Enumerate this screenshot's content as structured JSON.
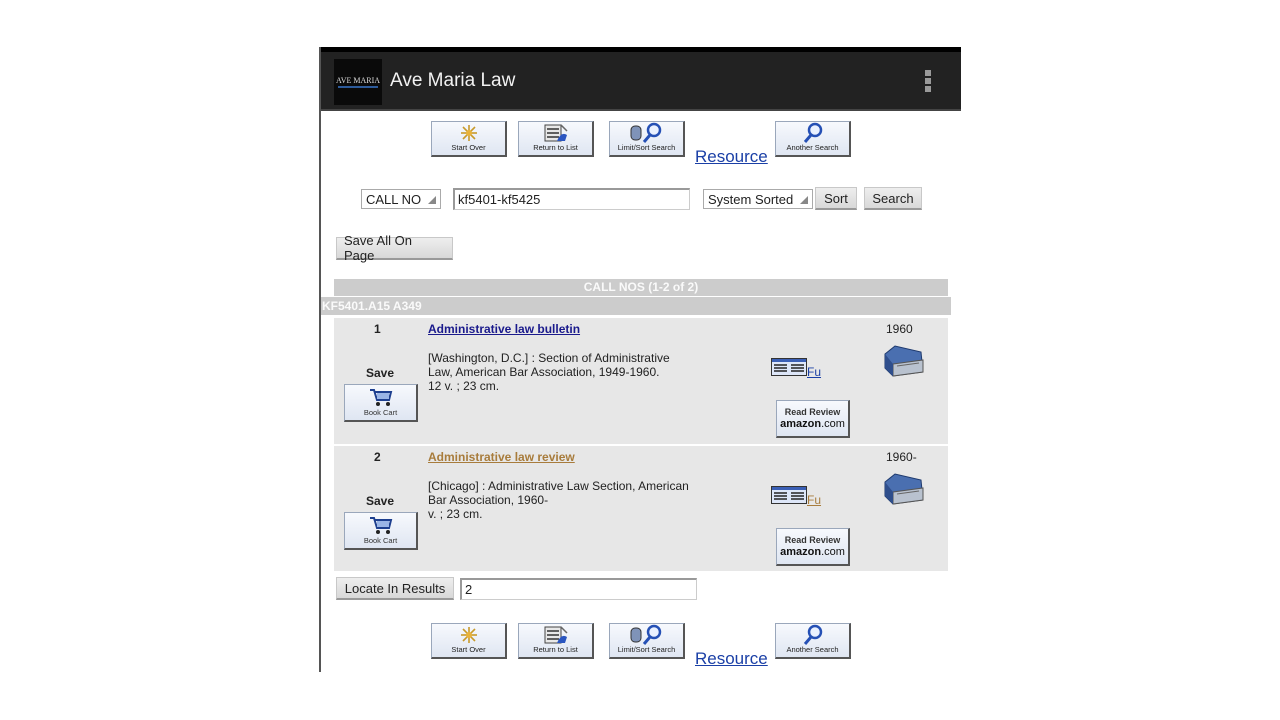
{
  "app": {
    "title": "Ave Maria Law",
    "logo_text": "AVE MARIA",
    "menu_icon": "overflow-menu-icon"
  },
  "nav": {
    "start_over": "Start Over",
    "return_to_list": "Return to List",
    "limit_sort": "Limit/Sort Search",
    "resource": "Resource",
    "another_search": "Another Search"
  },
  "search": {
    "index_select": "CALL NO",
    "query": "kf5401-kf5425",
    "sort_select": "System Sorted",
    "sort_button": "Sort",
    "search_button": "Search"
  },
  "save_all_button": "Save All On Page",
  "results": {
    "header": "CALL NOS (1-2 of 2)",
    "call_number": "KF5401.A15 A349",
    "records": [
      {
        "number": "1",
        "title": "Administrative law bulletin",
        "title_color": "#1a1a8c",
        "year": "1960",
        "description_lines": [
          "[Washington, D.C.] : Section of Administrative",
          "Law, American Bar Association, 1949-1960.",
          "12 v. ; 23 cm."
        ],
        "save_label": "Save",
        "cart_label": "Book Cart",
        "fulltext_label": "Fu",
        "review_label": "Read Review",
        "amazon_label_bold": "amazon",
        "amazon_label_rest": ".com"
      },
      {
        "number": "2",
        "title": "Administrative law review",
        "title_color": "#a87c3c",
        "year": "1960-",
        "description_lines": [
          "[Chicago] : Administrative Law Section, American",
          "Bar Association, 1960-",
          "v. ; 23 cm."
        ],
        "save_label": "Save",
        "cart_label": "Book Cart",
        "fulltext_label": "Fu",
        "review_label": "Read Review",
        "amazon_label_bold": "amazon",
        "amazon_label_rest": ".com"
      }
    ]
  },
  "locate": {
    "button": "Locate In Results",
    "value": "2"
  }
}
